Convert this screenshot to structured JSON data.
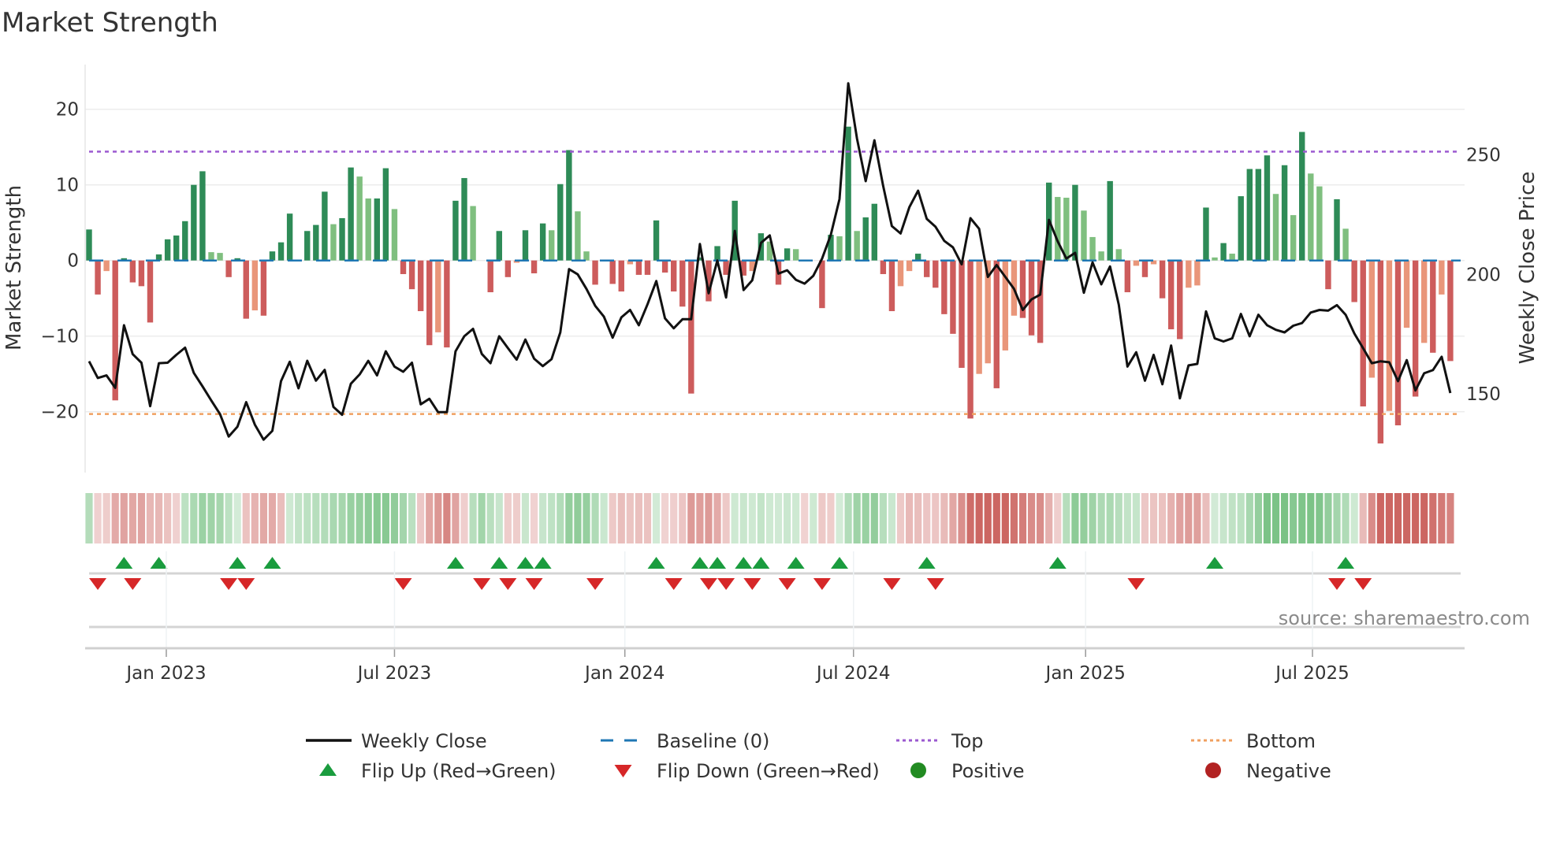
{
  "title": "Market Strength",
  "source": "source: sharemaestro.com",
  "chart_data": {
    "type": "bar",
    "title": "Market Strength",
    "ylabel": "Market Strength",
    "y2label": "Weekly Close Price",
    "ylim": [
      -26,
      24
    ],
    "y2lim": [
      126,
      286
    ],
    "yticks": [
      {
        "v": 20,
        "label": "20"
      },
      {
        "v": 10,
        "label": "10"
      },
      {
        "v": 0,
        "label": "0"
      },
      {
        "v": -10,
        "label": "−10"
      },
      {
        "v": -20,
        "label": "−20"
      }
    ],
    "y2ticks": [
      {
        "v": 250,
        "label": "250"
      },
      {
        "v": 200,
        "label": "200"
      },
      {
        "v": 150,
        "label": "150"
      }
    ],
    "xticks": [
      {
        "week": 8.85,
        "label": "Jan 2023"
      },
      {
        "week": 35.0,
        "label": "Jul 2023"
      },
      {
        "week": 61.4,
        "label": "Jan 2024"
      },
      {
        "week": 87.6,
        "label": "Jul 2024"
      },
      {
        "week": 114.2,
        "label": "Jan 2025"
      },
      {
        "week": 140.2,
        "label": "Jul 2025"
      }
    ],
    "top_level": 14.4,
    "bottom_level": -20.3,
    "baseline": 0,
    "colors": {
      "pos_up": "#2e8b57",
      "pos_down": "#7fbf7f",
      "neg_down": "#cd5c5c",
      "neg_up": "#e9967a",
      "line": "#111111",
      "baseline": "#1f77b4",
      "top": "#9b59d0",
      "bottom": "#f0a060",
      "flip_up": "#1a9c3e",
      "flip_down": "#d62728",
      "positive": "#228b22",
      "negative": "#b22222"
    },
    "strength": [
      4.1,
      -4.5,
      -1.4,
      -18.5,
      0.3,
      -2.9,
      -3.4,
      -8.2,
      0.8,
      2.8,
      3.3,
      5.2,
      10,
      11.8,
      1.1,
      1.0,
      -2.2,
      0.3,
      -7.7,
      -6.6,
      -7.3,
      1.2,
      2.4,
      6.2,
      0,
      3.9,
      4.7,
      9.1,
      4.8,
      5.6,
      12.3,
      11.1,
      8.2,
      8.2,
      12.2,
      6.8,
      -1.8,
      -3.8,
      -6.7,
      -11.2,
      -9.5,
      -11.5,
      7.9,
      10.9,
      7.2,
      0,
      -4.2,
      3.9,
      -2.2,
      -0.3,
      4.0,
      -1.7,
      4.9,
      4.0,
      10.1,
      14.6,
      6.5,
      1.2,
      -3.2,
      0,
      -3.1,
      -4.1,
      -0.5,
      -1.9,
      -1.9,
      5.3,
      -1.6,
      -4.1,
      -6.1,
      -17.6,
      0.4,
      -5.4,
      1.9,
      -1.9,
      7.9,
      -2.0,
      -1.4,
      3.6,
      2.5,
      -3.2,
      1.6,
      1.5,
      0,
      0,
      -6.3,
      3.4,
      3.2,
      17.7,
      3.9,
      5.7,
      7.5,
      -1.8,
      -6.7,
      -3.4,
      -1.4,
      0.9,
      -2.2,
      -3.6,
      -7.1,
      -9.7,
      -14.2,
      -20.9,
      -15,
      -13.6,
      -16.9,
      -11.9,
      -7.3,
      -7.6,
      -9.9,
      -10.9,
      10.3,
      8.4,
      8.3,
      10.0,
      6.6,
      3.1,
      1.2,
      10.5,
      1.5,
      -4.2,
      -0.7,
      -2.2,
      -0.5,
      -5.0,
      -9.1,
      -10.4,
      -3.6,
      -3.3,
      7.0,
      0.4,
      2.3,
      0.9,
      8.5,
      12.1,
      12.1,
      13.9,
      8.8,
      12.6,
      6.0,
      17.0,
      11.5,
      9.8,
      -3.8,
      8.1,
      4.2,
      -5.5,
      -19.3,
      -15.5,
      -24.2,
      -19.9,
      -21.8,
      -8.9,
      -18.0,
      -10.9,
      -12.2,
      -4.5,
      -13.3
    ],
    "weekly_close": [
      163.6,
      156.6,
      157.7,
      152.5,
      178.7,
      166.6,
      163,
      144.8,
      162.8,
      163,
      166.3,
      169.3,
      158.8,
      153.1,
      147.2,
      141.5,
      132.1,
      136.2,
      146.5,
      137.1,
      130.8,
      134.5,
      155.3,
      163.4,
      152.3,
      163.8,
      155.5,
      160,
      144.5,
      141.2,
      154.2,
      158.1,
      163.8,
      157.7,
      167.8,
      161.4,
      159.2,
      163,
      145.6,
      147.9,
      142.3,
      142.3,
      167.8,
      174.1,
      177.2,
      166.7,
      162.8,
      174.1,
      169.1,
      164.3,
      172.7,
      164.7,
      161.6,
      164.5,
      175.7,
      202.2,
      200,
      193.9,
      186.8,
      182.3,
      173.5,
      182,
      185.1,
      178.7,
      187.5,
      197.2,
      181.6,
      177.4,
      181.2,
      181.2,
      212.7,
      192.1,
      205.8,
      190.3,
      218.2,
      193.4,
      197.5,
      213.2,
      216.3,
      200.3,
      201.7,
      197.7,
      196.1,
      199.4,
      206.6,
      216.6,
      231.5,
      280,
      256.8,
      239,
      256.1,
      237,
      220.2,
      217.1,
      228.1,
      235,
      223.2,
      219.9,
      214,
      211.3,
      204.2,
      223.5,
      219.1,
      198.9,
      203.9,
      198.9,
      193.9,
      185.1,
      189.5,
      191.5,
      222.8,
      213.8,
      206.6,
      209,
      192.3,
      205,
      195.8,
      203.3,
      187.3,
      161.4,
      167.4,
      155.5,
      166.3,
      154,
      170.2,
      148.1,
      161.9,
      162.5,
      184.5,
      173.2,
      171.9,
      173.2,
      183.4,
      174.1,
      183.1,
      178.7,
      176.8,
      175.7,
      178.5,
      179.6,
      184,
      185.1,
      184.8,
      187.1,
      183.1,
      175.2,
      169.1,
      162.8,
      163.6,
      163.2,
      155.3,
      164.1,
      151.4,
      158.6,
      159.9,
      165.5,
      150.3
    ],
    "flip_up_weeks": [
      4,
      8,
      17,
      21,
      42,
      47,
      50,
      52,
      65,
      70,
      72,
      75,
      77,
      81,
      86,
      96,
      111,
      129,
      144
    ],
    "flip_down_weeks": [
      1,
      5,
      16,
      18,
      36,
      45,
      48,
      51,
      58,
      67,
      71,
      73,
      76,
      80,
      84,
      92,
      97,
      120,
      143,
      146
    ],
    "legend": {
      "placement": "bottom",
      "items": [
        {
          "label": "Weekly Close",
          "kind": "line"
        },
        {
          "label": "Baseline (0)",
          "kind": "baseline"
        },
        {
          "label": "Top",
          "kind": "top"
        },
        {
          "label": "Bottom",
          "kind": "bottom"
        },
        {
          "label": "Flip Up (Red→Green)",
          "kind": "flip_up"
        },
        {
          "label": "Flip Down (Green→Red)",
          "kind": "flip_down"
        },
        {
          "label": "Positive",
          "kind": "positive"
        },
        {
          "label": "Negative",
          "kind": "negative"
        }
      ]
    }
  }
}
